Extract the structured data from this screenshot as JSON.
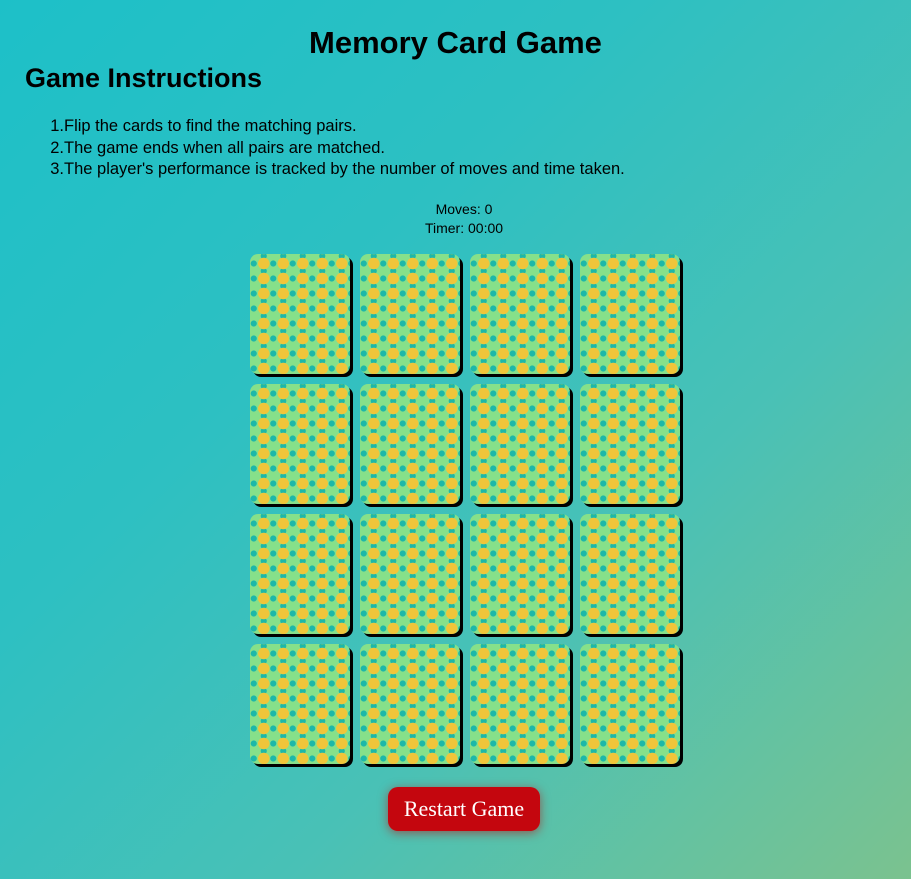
{
  "title": "Memory Card Game",
  "instructions": {
    "heading": "Game Instructions",
    "items": [
      "Flip the cards to find the matching pairs.",
      "The game ends when all pairs are matched.",
      "The player's performance is tracked by the number of moves and time taken."
    ]
  },
  "stats": {
    "moves_label": "Moves:",
    "moves": "0",
    "timer_label": "Timer:",
    "timer": "00:00"
  },
  "board": {
    "rows": 4,
    "columns": 4,
    "cards_face_down": 16
  },
  "restart_label": "Restart Game",
  "colors": {
    "card_back": "#86e08a",
    "card_dot_large": "#f0c53a",
    "card_dot_small": "#1db8a8",
    "restart_button": "#c4060e"
  }
}
